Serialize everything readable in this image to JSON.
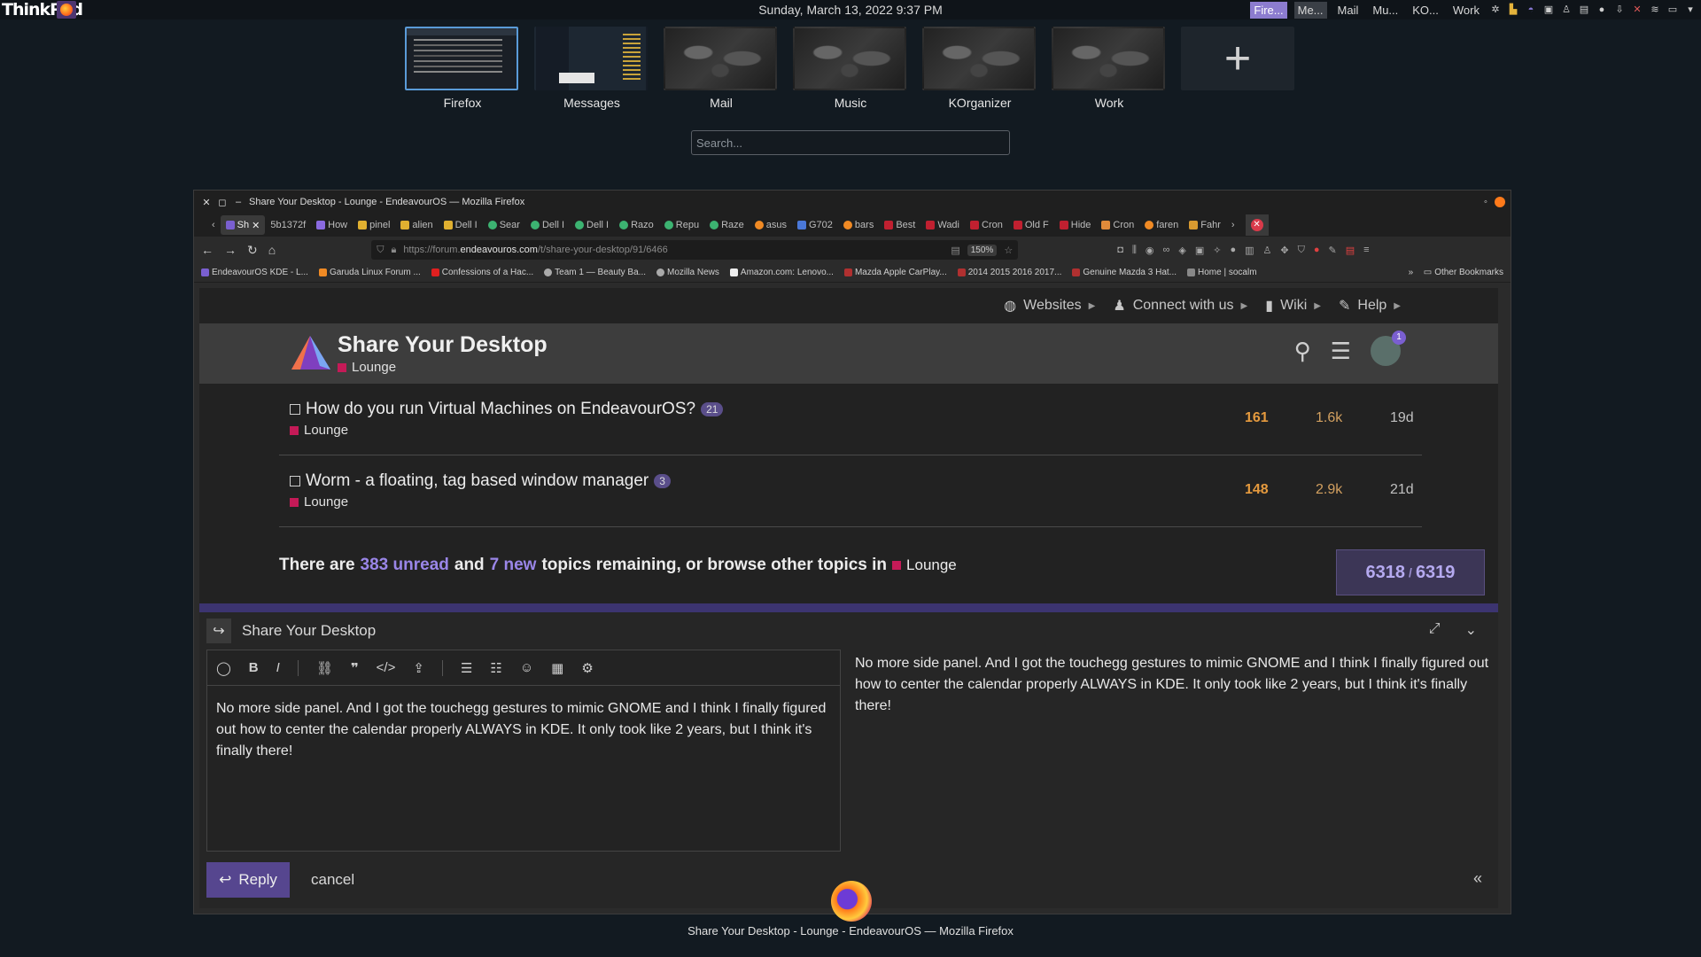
{
  "topbar": {
    "brand": "ThinkPad",
    "clock": "Sunday, March 13, 2022   9:37 PM",
    "tasks": [
      "Fire...",
      "Me...",
      "Mail",
      "Mu...",
      "KO...",
      "Work"
    ]
  },
  "activities": [
    {
      "name": "Firefox"
    },
    {
      "name": "Messages"
    },
    {
      "name": "Mail"
    },
    {
      "name": "Music"
    },
    {
      "name": "KOrganizer"
    },
    {
      "name": "Work"
    }
  ],
  "search": {
    "placeholder": "Search..."
  },
  "window": {
    "title": "Share Your Desktop - Lounge - EndeavourOS — Mozilla Firefox",
    "tabs": [
      "Sh",
      "5b1372f",
      "How",
      "pinel",
      "alien",
      "Dell I",
      "Sear",
      "Dell I",
      "Dell I",
      "Razo",
      "Repu",
      "Raze",
      "asus",
      "G702",
      "bars",
      "Best",
      "Wadi",
      "Cron",
      "Old F",
      "Hide",
      "Cron",
      "faren",
      "Fahr"
    ],
    "url_prefix": "https://forum.",
    "url_domain": "endeavouros.com",
    "url_suffix": "/t/share-your-desktop/91/6466",
    "zoom": "150%",
    "bookmarks": [
      "EndeavourOS KDE - L...",
      "Garuda Linux Forum ...",
      "Confessions of a Hac...",
      "Team 1 — Beauty Ba...",
      "Mozilla News",
      "Amazon.com: Lenovo...",
      "Mazda Apple CarPlay...",
      "2014 2015 2016 2017...",
      "Genuine Mazda 3 Hat...",
      "Home | socalm"
    ],
    "other_bookmarks": "Other Bookmarks"
  },
  "forum": {
    "nav": [
      "Websites",
      "Connect with us",
      "Wiki",
      "Help"
    ],
    "title": "Share Your Desktop",
    "category": "Lounge",
    "notif_count": "1",
    "topics": [
      {
        "title": "How do you run Virtual Machines on EndeavourOS?",
        "count": "21",
        "category": "Lounge",
        "replies": "161",
        "views": "1.6k",
        "activity": "19d"
      },
      {
        "title": "Worm - a floating, tag based window manager",
        "count": "3",
        "category": "Lounge",
        "replies": "148",
        "views": "2.9k",
        "activity": "21d"
      }
    ],
    "remaining": {
      "pre": "There are",
      "unread": "383 unread",
      "and": "and",
      "new": "7 new",
      "post": "topics remaining, or browse other topics in",
      "category": "Lounge"
    },
    "progress": {
      "current": "6318",
      "sep": "/",
      "total": "6319"
    }
  },
  "composer": {
    "topic": "Share Your Desktop",
    "text": "No more side panel.  And I got the touchegg gestures to mimic GNOME and I think I finally figured out how to center the calendar properly ALWAYS in KDE.  It only took like 2 years, but I think it's finally there!",
    "preview": "No more side panel. And I got the touchegg gestures to mimic GNOME and I think I finally figured out how to center the calendar properly ALWAYS in KDE. It only took like 2 years, but I think it's finally there!",
    "reply_label": "Reply",
    "cancel_label": "cancel"
  },
  "caption": "Share Your Desktop - Lounge - EndeavourOS — Mozilla Firefox",
  "colors": {
    "accent": "#56468f",
    "lounge": "#c41a57",
    "link": "#9a86e8",
    "replies": "#e59a3e"
  }
}
